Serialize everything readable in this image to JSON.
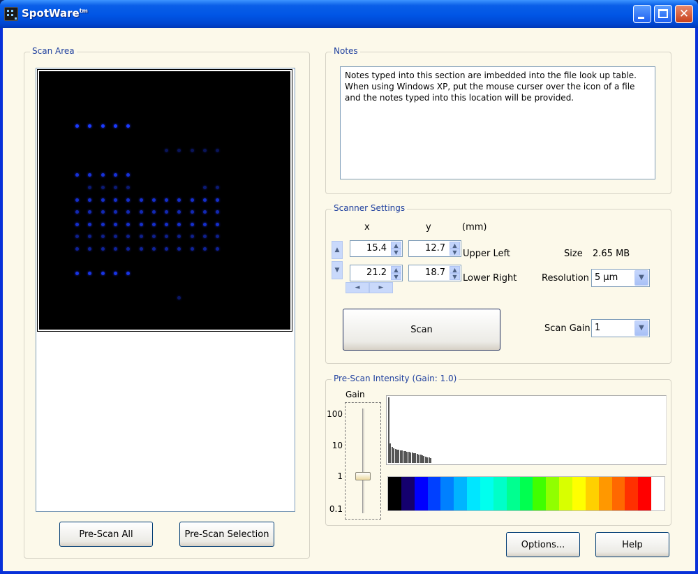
{
  "window": {
    "title": "SpotWare",
    "title_mark": "tm"
  },
  "scan_area": {
    "title": "Scan Area",
    "pre_scan_all_label": "Pre-Scan All",
    "pre_scan_selection_label": "Pre-Scan Selection"
  },
  "notes": {
    "title": "Notes",
    "text": "Notes typed into this section are imbedded into the file look up table. When using Windows XP, put the mouse curser over the icon of a file and the notes typed into this location will be provided."
  },
  "scanner_settings": {
    "title": "Scanner Settings",
    "x_header": "x",
    "y_header": "y",
    "units": "(mm)",
    "upper_left_label": "Upper Left",
    "lower_right_label": "Lower Right",
    "upper_left_x": "15.4",
    "upper_left_y": "12.7",
    "lower_right_x": "21.2",
    "lower_right_y": "18.7",
    "size_label": "Size",
    "size_value": "2.65 MB",
    "resolution_label": "Resolution",
    "resolution_value": "5 µm",
    "scan_label": "Scan",
    "scan_gain_label": "Scan Gain",
    "scan_gain_value": "1"
  },
  "pre_scan_intensity": {
    "title": "Pre-Scan Intensity (Gain: 1.0)",
    "gain_label": "Gain",
    "gain_ticks": [
      "100",
      "10",
      "1",
      "0.1"
    ],
    "gain_value": 1.0,
    "histogram_heights": [
      1.0,
      0.3,
      0.24,
      0.22,
      0.21,
      0.2,
      0.2,
      0.19,
      0.19,
      0.18,
      0.18,
      0.17,
      0.17,
      0.16,
      0.16,
      0.15,
      0.15,
      0.14,
      0.13,
      0.13,
      0.12,
      0.11,
      0.1,
      0.09,
      0.08,
      0.07
    ],
    "colors": [
      "#000000",
      "#14006e",
      "#0000ff",
      "#0040ff",
      "#0080ff",
      "#00b4ff",
      "#00e6ff",
      "#00ffee",
      "#00ffc8",
      "#00ff90",
      "#00ff50",
      "#40ff00",
      "#90ff00",
      "#d8ff00",
      "#ffff00",
      "#ffd000",
      "#ff9800",
      "#ff6800",
      "#ff3000",
      "#ff0000",
      "#ffffff"
    ]
  },
  "footer": {
    "options_label": "Options...",
    "help_label": "Help"
  },
  "icons": {
    "app": "app-icon",
    "minimize": "minimize-icon",
    "maximize": "maximize-icon",
    "close": "close-icon"
  }
}
